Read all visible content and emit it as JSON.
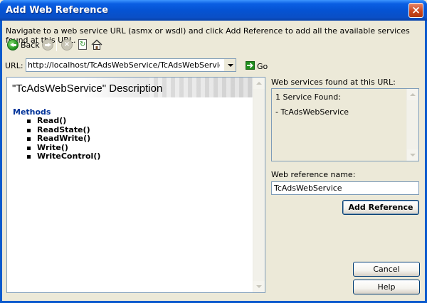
{
  "window": {
    "title": "Add Web Reference",
    "close_glyph": "×"
  },
  "instructions": "Navigate to a web service URL (asmx or wsdl) and click Add Reference to add all the available services found at this URL.",
  "toolbar": {
    "back_label": "Back",
    "stop_glyph": "×",
    "icons": [
      "back-icon",
      "forward-icon",
      "stop-icon",
      "refresh-icon",
      "home-icon"
    ]
  },
  "url": {
    "label": "URL:",
    "value": "http://localhost/TcAdsWebService/TcAdsWebService.WSDL",
    "go_label": "Go"
  },
  "description": {
    "title": "\"TcAdsWebService\" Description",
    "methods_heading": "Methods",
    "methods": [
      "Read()",
      "ReadState()",
      "ReadWrite()",
      "Write()",
      "WriteControl()"
    ]
  },
  "services": {
    "label": "Web services found at this URL:",
    "count_text": "1 Service Found:",
    "items": [
      "- TcAdsWebService"
    ]
  },
  "reference": {
    "label": "Web reference name:",
    "value": "TcAdsWebService"
  },
  "buttons": {
    "add_reference": "Add Reference",
    "cancel": "Cancel",
    "help": "Help"
  },
  "colors": {
    "titlebar": "#0553D3",
    "dialog_bg": "#ECE9D8",
    "methods_heading": "#003399",
    "input_border": "#7F9DB9"
  }
}
